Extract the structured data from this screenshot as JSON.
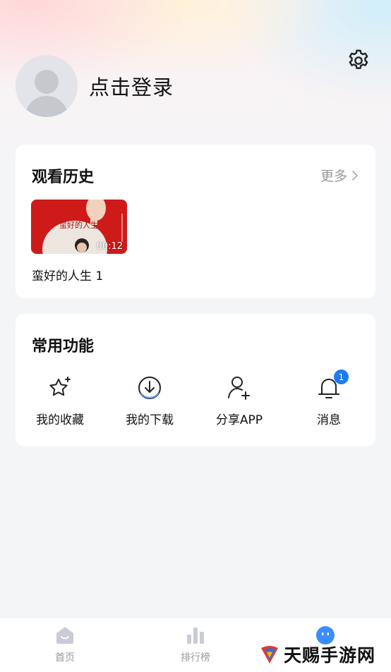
{
  "header": {
    "login_text": "点击登录"
  },
  "history": {
    "title": "观看历史",
    "more_label": "更多",
    "items": [
      {
        "title": "蛮好的人生 1",
        "duration": "00:12",
        "poster_text": "蛮好的人生"
      }
    ]
  },
  "functions": {
    "title": "常用功能",
    "items": [
      {
        "label": "我的收藏",
        "icon": "star-sparkle-icon"
      },
      {
        "label": "我的下载",
        "icon": "download-icon"
      },
      {
        "label": "分享APP",
        "icon": "share-user-icon"
      },
      {
        "label": "消息",
        "icon": "bell-icon",
        "badge": "1"
      }
    ]
  },
  "bottom_nav": {
    "items": [
      {
        "label": "首页",
        "icon": "home-icon"
      },
      {
        "label": "排行榜",
        "icon": "ranking-icon"
      },
      {
        "label": "",
        "icon": "profile-icon"
      }
    ]
  },
  "watermark": {
    "text": "天赐手游网"
  },
  "colors": {
    "accent": "#1e7cf2",
    "badge": "#1e7cf2",
    "nav_inactive": "#c9cbd6",
    "nav_active": "#3a8dff"
  }
}
